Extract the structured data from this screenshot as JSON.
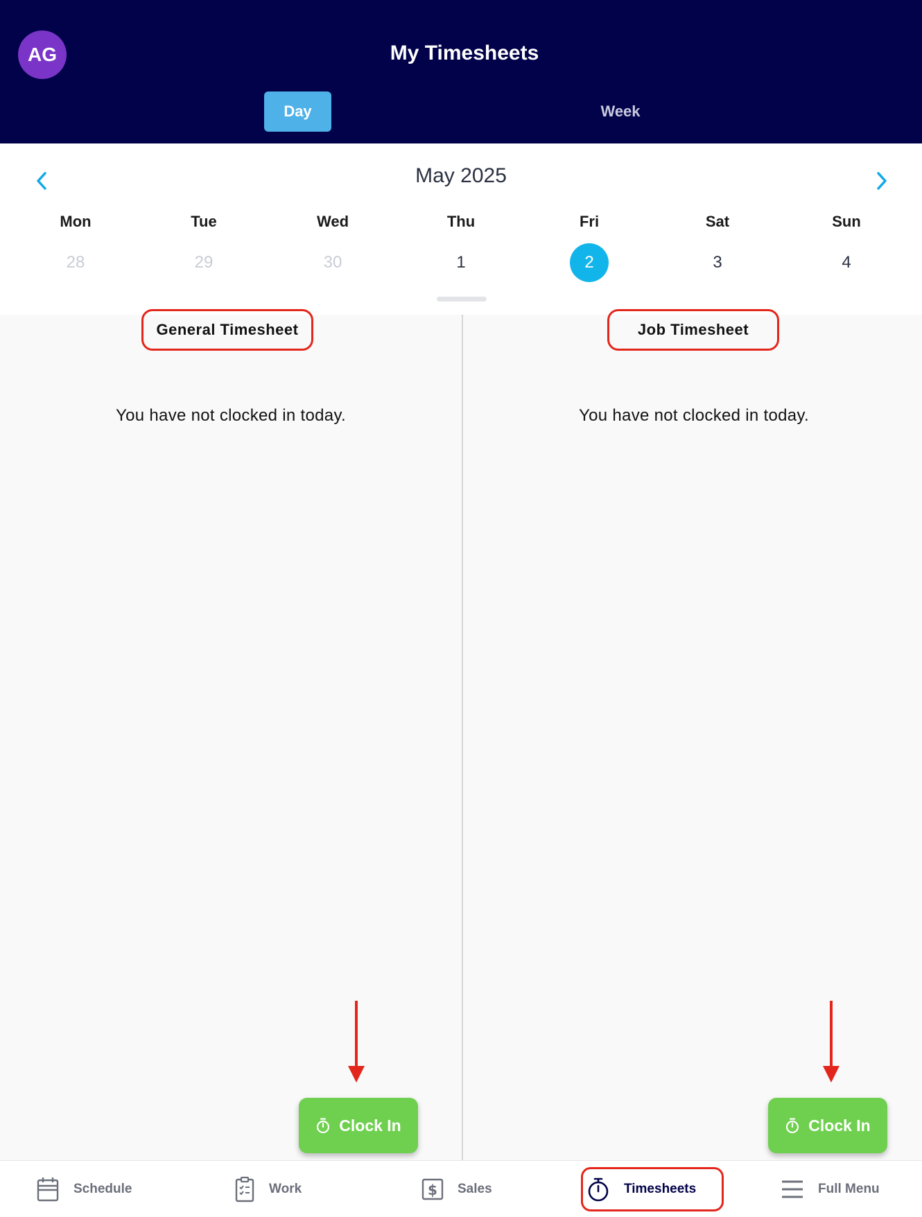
{
  "header": {
    "avatar_initials": "AG",
    "title": "My Timesheets",
    "tabs": [
      {
        "label": "Day",
        "active": true
      },
      {
        "label": "Week",
        "active": false
      }
    ],
    "background_color": "#02024a",
    "avatar_color": "#7a35c8"
  },
  "calendar": {
    "month_label": "May 2025",
    "prev_icon": "chevron-left-icon",
    "next_icon": "chevron-right-icon",
    "days": [
      {
        "name": "Mon",
        "number": "28",
        "muted": true
      },
      {
        "name": "Tue",
        "number": "29",
        "muted": true
      },
      {
        "name": "Wed",
        "number": "30",
        "muted": true
      },
      {
        "name": "Thu",
        "number": "1",
        "muted": false
      },
      {
        "name": "Fri",
        "number": "2",
        "selected": true
      },
      {
        "name": "Sat",
        "number": "3",
        "muted": false
      },
      {
        "name": "Sun",
        "number": "4",
        "muted": false
      }
    ],
    "selected_color": "#12b5ea"
  },
  "panels": {
    "general": {
      "title": "General Timesheet",
      "empty_message": "You have not clocked in today.",
      "clock_in_label": "Clock In"
    },
    "job": {
      "title": "Job Timesheet",
      "empty_message": "You have not clocked in today.",
      "clock_in_label": "Clock In"
    },
    "clock_in_color": "#6fd04f",
    "highlight_color": "#e3261b"
  },
  "bottom_nav": {
    "items": [
      {
        "label": "Schedule",
        "icon": "calendar-icon",
        "active": false
      },
      {
        "label": "Work",
        "icon": "clipboard-checklist-icon",
        "active": false
      },
      {
        "label": "Sales",
        "icon": "dollar-document-icon",
        "active": false
      },
      {
        "label": "Timesheets",
        "icon": "stopwatch-icon",
        "active": true
      },
      {
        "label": "Full Menu",
        "icon": "hamburger-menu-icon",
        "active": false
      }
    ]
  }
}
